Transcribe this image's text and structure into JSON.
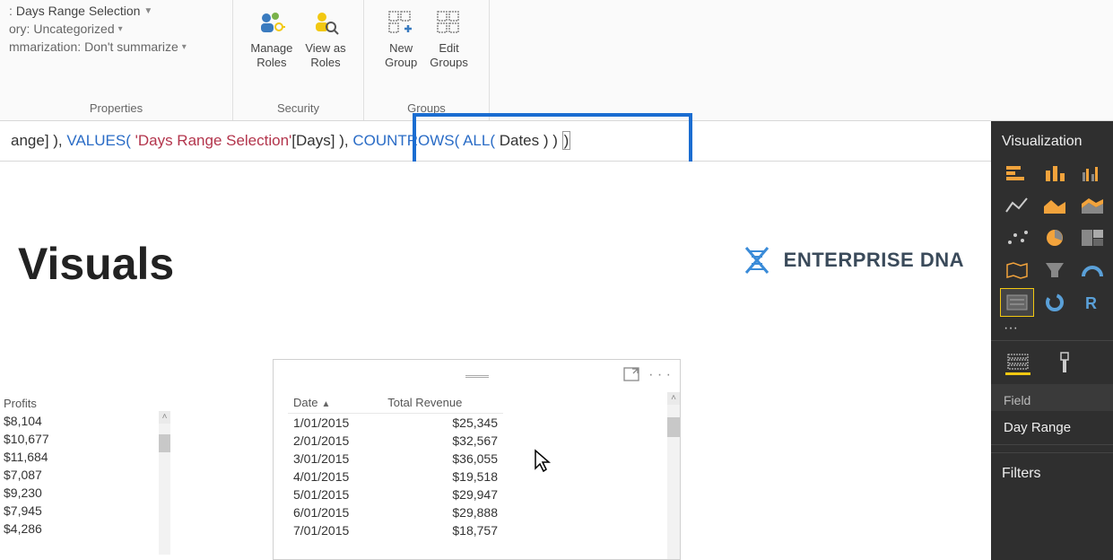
{
  "ribbon": {
    "properties": {
      "row1_prefix": ":",
      "row1_value": "Days Range Selection",
      "row2_prefix": "ory:",
      "row2_value": "Uncategorized",
      "row3_prefix": "mmarization:",
      "row3_value": "Don't summarize",
      "group_label": "Properties"
    },
    "security": {
      "manage_l1": "Manage",
      "manage_l2": "Roles",
      "viewas_l1": "View as",
      "viewas_l2": "Roles",
      "group_label": "Security"
    },
    "groups": {
      "new_l1": "New",
      "new_l2": "Group",
      "edit_l1": "Edit",
      "edit_l2": "Groups",
      "group_label": "Groups"
    }
  },
  "formula": {
    "seg1": "ange] ), ",
    "func1": "VALUES(",
    "str1": " 'Days Range Selection'",
    "seg2": "[Days] ), ",
    "func2": "COUNTROWS(",
    "func3": " ALL(",
    "seg3": " Dates ) ) ",
    "endp": ")"
  },
  "canvas": {
    "heading": "Visuals",
    "logo_text": "ENTERPRISE DNA"
  },
  "left_table": {
    "header": "Profits",
    "rows": [
      "$8,104",
      "$10,677",
      "$11,684",
      "$7,087",
      "$9,230",
      "$7,945",
      "$4,286"
    ]
  },
  "rev_table": {
    "col1": "Date",
    "col2": "Total Revenue",
    "rows": [
      {
        "d": "1/01/2015",
        "r": "$25,345"
      },
      {
        "d": "2/01/2015",
        "r": "$32,567"
      },
      {
        "d": "3/01/2015",
        "r": "$36,055"
      },
      {
        "d": "4/01/2015",
        "r": "$19,518"
      },
      {
        "d": "5/01/2015",
        "r": "$29,947"
      },
      {
        "d": "6/01/2015",
        "r": "$29,888"
      },
      {
        "d": "7/01/2015",
        "r": "$18,757"
      }
    ]
  },
  "rpanel": {
    "title": "Visualization",
    "ellipsis": "···",
    "field_section": "Field",
    "field_item": "Day Range",
    "filters_section": "Filters"
  }
}
